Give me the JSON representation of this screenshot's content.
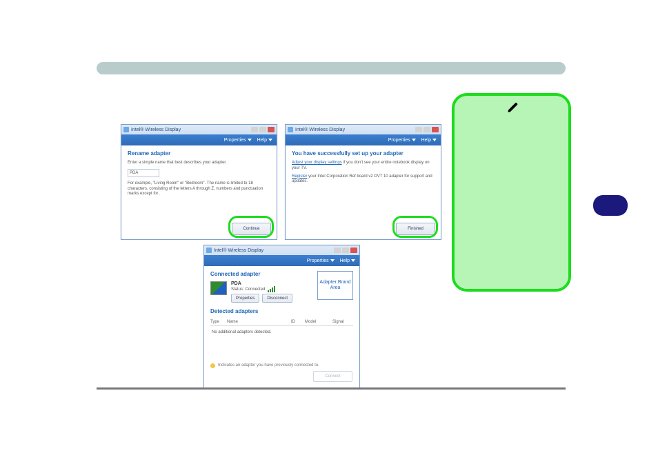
{
  "windowTitle": "Intel® Wireless Display",
  "blueBar": {
    "properties": "Properties",
    "help": "Help"
  },
  "rename": {
    "heading": "Rename adapter",
    "prompt": "Enter a simple name that best describes your adapter.",
    "value": "PDA",
    "hint": "For example, \"Living Room\" or \"Bedroom\". The name is limited to 18 characters, consisting of the letters A through Z, numbers and punctuation marks except for .",
    "button": "Continue"
  },
  "success": {
    "heading": "You have successfully set up your adapter",
    "line1a": "Adjust your display settings",
    "line1b": " if you don't see your entire notebook display on your TV.",
    "line2a": "Register",
    "line2b": " your Intel Corporation Ref board v2 DVT 10 adapter for support and updates.",
    "button": "Finished"
  },
  "status": {
    "connectedHeading": "Connected adapter",
    "name": "PDA",
    "statusLine": "Status: Connected",
    "propertiesBtn": "Properties",
    "disconnectBtn": "Disconnect",
    "brandBox": "Adapter Brand Area",
    "detectedHeading": "Detected adapters",
    "cols": {
      "type": "Type",
      "name": "Name",
      "id": "ID",
      "model": "Model",
      "signal": "Signal"
    },
    "empty": "No additional adapters detected.",
    "prevNote": "Indicates an adapter you have previously connected to.",
    "ghostBtn": "Connect"
  }
}
